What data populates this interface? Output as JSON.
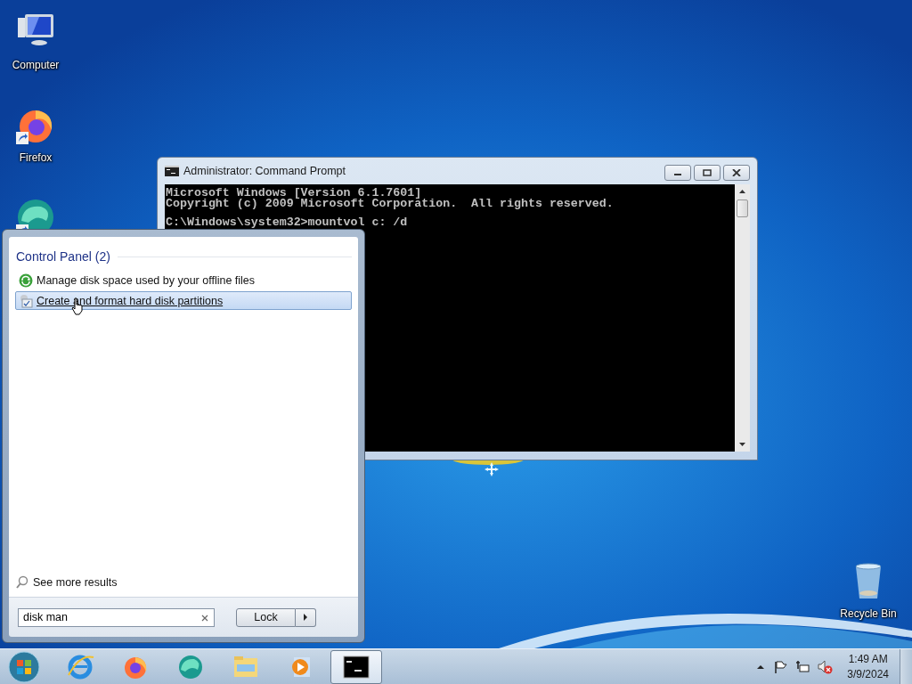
{
  "desktop_icons": [
    {
      "kind": "computer",
      "label": "Computer",
      "shortcut": false
    },
    {
      "kind": "firefox",
      "label": "Firefox",
      "shortcut": true
    },
    {
      "kind": "edge",
      "shortcut": true
    },
    {
      "kind": "recycle",
      "label": "Recycle Bin",
      "shortcut": false
    }
  ],
  "console_window": {
    "title": "Administrator:  Command Prompt",
    "lines": [
      {
        "kind": "output",
        "text": "Microsoft Windows [Version 6.1.7601]"
      },
      {
        "kind": "output",
        "text": "Copyright (c) 2009 Microsoft Corporation.  All rights reserved."
      },
      {
        "kind": "prompt",
        "text": "C:\\Windows\\system32>mountvol c: /d"
      }
    ]
  },
  "start_menu": {
    "group_heading": "Control Panel (2)",
    "results": [
      {
        "kind": "offline",
        "label": "Manage disk space used by your offline files",
        "selected": false
      },
      {
        "kind": "disk",
        "label": "Create and format hard disk partitions",
        "selected": true
      }
    ],
    "see_more": "See more results",
    "search": {
      "value": "disk man"
    },
    "power_button": "Lock"
  },
  "taskbar": {
    "items": [
      {
        "kind": "ie",
        "selected": false
      },
      {
        "kind": "firefox",
        "selected": false
      },
      {
        "kind": "edge",
        "selected": false
      },
      {
        "kind": "explorer",
        "selected": false
      },
      {
        "kind": "media",
        "selected": false
      },
      {
        "kind": "cmd",
        "selected": true
      }
    ],
    "clock": {
      "time": "1:49 AM",
      "date": "3/9/2024"
    }
  }
}
